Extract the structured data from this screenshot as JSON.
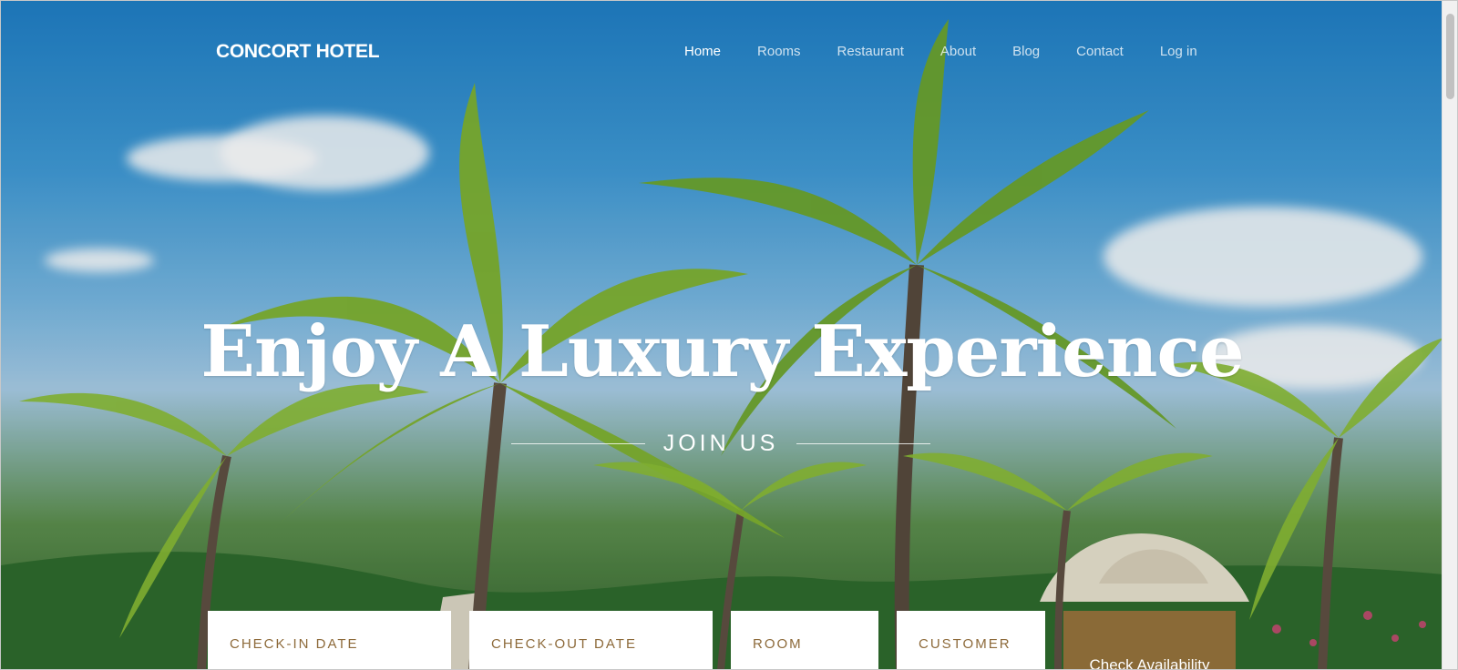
{
  "brand": {
    "name": "CONCORT HOTEL"
  },
  "nav": {
    "items": [
      {
        "label": "Home",
        "active": true
      },
      {
        "label": "Rooms",
        "active": false
      },
      {
        "label": "Restaurant",
        "active": false
      },
      {
        "label": "About",
        "active": false
      },
      {
        "label": "Blog",
        "active": false
      },
      {
        "label": "Contact",
        "active": false
      },
      {
        "label": "Log in",
        "active": false
      }
    ]
  },
  "hero": {
    "headline": "Enjoy A Luxury Experience",
    "subtitle": "JOIN US"
  },
  "booking": {
    "checkin_label": "CHECK-IN DATE",
    "checkout_label": "CHECK-OUT DATE",
    "room_label": "ROOM",
    "customer_label": "CUSTOMER",
    "button_label": "Check Availability"
  },
  "colors": {
    "accent": "#8a6a37",
    "label": "#8d6a3a",
    "sky": "#3f9ad6"
  }
}
